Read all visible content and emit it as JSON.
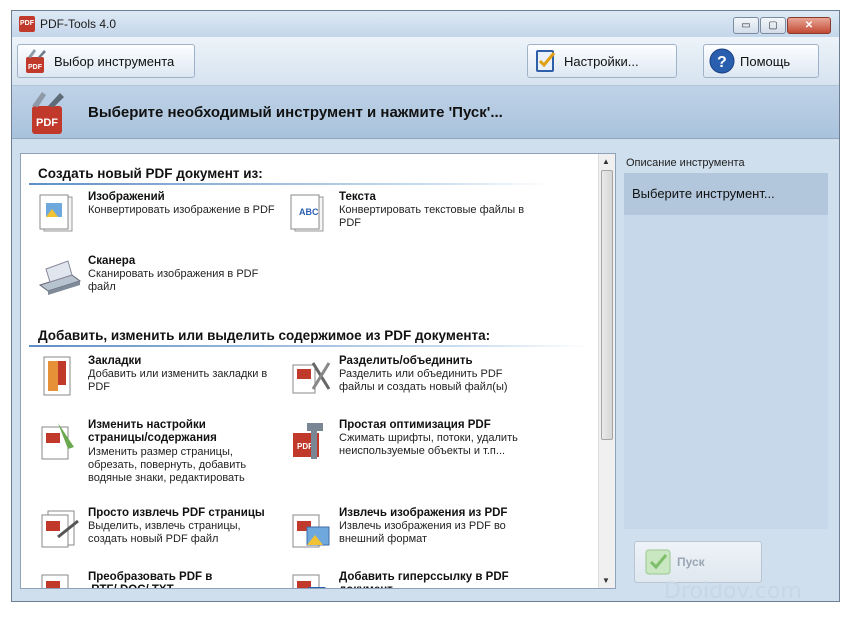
{
  "window": {
    "title": "PDF-Tools 4.0",
    "app_icon": "pdf-tools-icon",
    "controls": {
      "minimize": "▭",
      "maximize": "▢",
      "close": "✕"
    }
  },
  "toolbar": {
    "tool_select_label": "Выбор инструмента",
    "settings_label": "Настройки...",
    "help_label": "Помощь"
  },
  "header": {
    "text": "Выберите необходимый инструмент и нажмите 'Пуск'..."
  },
  "sections": [
    {
      "heading": "Создать новый PDF документ из:",
      "tools": [
        {
          "name": "Изображений",
          "desc": "Конвертировать изображение в PDF",
          "icon": "image-doc-icon"
        },
        {
          "name": "Текста",
          "desc": "Конвертировать текстовые файлы в PDF",
          "icon": "text-doc-icon"
        },
        {
          "name": "Сканера",
          "desc": "Сканировать изображения в PDF файл",
          "icon": "scanner-icon"
        }
      ]
    },
    {
      "heading": "Добавить, изменить или выделить содержимое из PDF документа:",
      "tools": [
        {
          "name": "Закладки",
          "desc": "Добавить или изменить закладки в PDF",
          "icon": "bookmark-icon"
        },
        {
          "name": "Разделить/объединить",
          "desc": "Разделить или объединить PDF файлы и создать новый файл(ы)",
          "icon": "split-merge-icon"
        },
        {
          "name": "Изменить настройки страницы/содержания",
          "desc": "Изменить размер страницы, обрезать, повернуть, добавить водяные знаки, редактировать",
          "icon": "page-settings-icon"
        },
        {
          "name": "Простая оптимизация PDF",
          "desc": "Сжимать шрифты, потоки, удалить неиспользуемые объекты и т.п...",
          "icon": "optimize-icon"
        },
        {
          "name": "Просто извлечь PDF страницы",
          "desc": "Выделить, извлечь страницы, создать новый PDF файл",
          "icon": "extract-pages-icon"
        },
        {
          "name": "Извлечь изображения из PDF",
          "desc": "Извлечь изображения из PDF во внешний формат",
          "icon": "extract-images-icon"
        },
        {
          "name": "Преобразовать PDF в .RTF/.DOC/.TXT",
          "desc": "",
          "icon": "convert-icon"
        },
        {
          "name": "Добавить гиперссылку в PDF документ",
          "desc": "",
          "icon": "hyperlink-icon"
        }
      ]
    }
  ],
  "side": {
    "label": "Описание инструмента",
    "selected_text": "Выберите инструмент..."
  },
  "start_button": {
    "label": "Пуск"
  },
  "watermark": "Droidov.com",
  "colors": {
    "accent": "#c0392b",
    "panel": "#c6d8ea",
    "header": "#a9c2dc"
  }
}
